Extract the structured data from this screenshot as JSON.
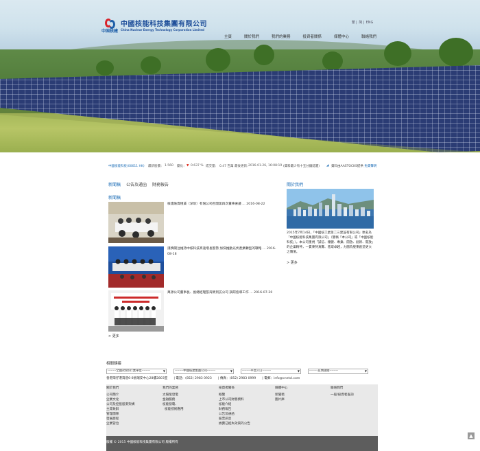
{
  "header": {
    "logo_cn": "中國核能科技集團有限公司",
    "logo_en": "China Nuclear Energy Technology Corporation Limited",
    "logo_sub": "中国核建",
    "lang": [
      "繁",
      "简",
      "ENG"
    ],
    "nav": [
      "主頁",
      "關於我們",
      "我們的業務",
      "投資者關係",
      "媒體中心",
      "聯絡我們"
    ]
  },
  "ticker": {
    "code": "中國核能科技(00611 HK)",
    "price_label": "最新股價：",
    "price": "1.560",
    "change_label": "變化：",
    "change": "0.637 %",
    "volume_label": "成交量：",
    "volume": "0.47 百萬",
    "updated_label": "最後更新：",
    "updated": "2016-01-26, 16:08:19",
    "note": "(資料最少有十五分鐘延遲)",
    "source_prefix": "資料由AASTOCKS提供",
    "source_link": "免責聲明"
  },
  "news": {
    "tabs": [
      "新聞稿",
      "公告及通函",
      "財務報告"
    ],
    "heading": "新聞稿",
    "items": [
      {
        "title": "核建融資租賃（深圳）有限公司召開第四次董事會議 ... 2016-08-22"
      },
      {
        "title": "謹慎關注維持中核科技高速增長態勢 加快推動光伏產業轉型的戰略 ... 2016-08-18"
      },
      {
        "title": "萬源公司董事長、副總經理張海榮到訪公司 調研指導工作 ... 2016-07-20"
      }
    ],
    "more": "> 更多"
  },
  "about": {
    "heading": "關於我們",
    "text": "2015年7月14日，「中國核工業第二三建設有限公司」更名為「中國核能科技集團有限公司」（簡稱「本公司」或「中國核能科技」）。本公司重視「誠信、穩健、專業、開放、創新、開放」的企業精神，一貫秉持真實、進取卓越，力圖為股東創造更大之價值。",
    "more": "> 更多"
  },
  "related": {
    "heading": "相關鏈接",
    "selects": [
      "--------全國/政府/行業單位--------",
      "--------中國核建集團公司--------",
      "--------平台入口--------",
      "--------友情鏈接--------"
    ],
    "address": "香港灣仔港灣道6-8號瑞安中心28樓2803室",
    "tel": "電話：(852) 2983 0923",
    "fax": "傳真：(852) 2983 0999",
    "email": "電郵：info@cnetcl.com"
  },
  "footer": {
    "columns": [
      {
        "heading": "關於我們",
        "items": [
          "公司簡介",
          "企業文化",
          "公司及控股股東架構",
          "主席致辭",
          "管理團隊",
          "發展歷程",
          "企業管治"
        ]
      },
      {
        "heading": "我們的業務",
        "items": [
          "太陽能發電",
          "金融服務",
          "核能發電、",
          "核能技術應用"
        ]
      },
      {
        "heading": "投資者關係",
        "items": [
          "概覽",
          "上市公司財務資料",
          "核能介紹",
          "財務報告",
          "公告及通函",
          "股票訊息",
          "據賣已經失效東的公告"
        ]
      },
      {
        "heading": "媒體中心",
        "items": [
          "新聞稿",
          "圖片庫"
        ]
      },
      {
        "heading": "聯絡我們",
        "items": [
          "一般/投資者查詢"
        ]
      }
    ],
    "copyright": "版權 © 2015 中國核能科技集團有限公司 版權所有"
  }
}
